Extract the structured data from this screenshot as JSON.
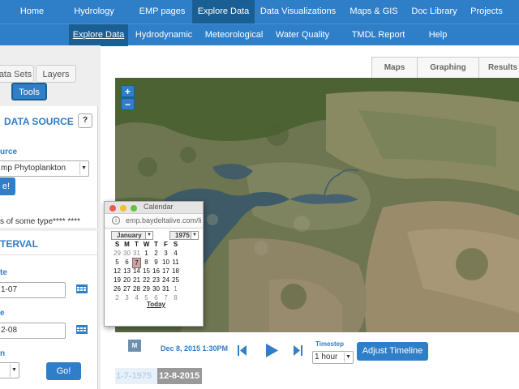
{
  "topnav": {
    "items": [
      "Home",
      "Hydrology Graphs",
      "EMP pages",
      "Explore Data",
      "Data Visualizations",
      "Maps & GIS",
      "Doc Library",
      "Projects"
    ]
  },
  "subnav": {
    "items": [
      "Explore Data",
      "Hydrodynamic",
      "Meteorological",
      "Water Quality",
      "TMDL Report Cards",
      "Help"
    ]
  },
  "left": {
    "tabs": [
      "ata Sets",
      "Layers"
    ],
    "tools_label": "Tools",
    "datasource_title": "DATA SOURCE",
    "help_label": "?",
    "source_label": "urce",
    "source_value": "mp Phytoplankton",
    "go1_label": "e!",
    "note": "s of some type**** ****",
    "interval_title": "TERVAL",
    "start_label": "te",
    "start_value": "1-07",
    "end_label": "e",
    "end_value": "2-08",
    "step_label": "n",
    "go2_label": "Go!"
  },
  "right_tabs": [
    "Maps",
    "Graphing",
    "Results"
  ],
  "map": {
    "zoom_in": "+",
    "zoom_out": "−"
  },
  "timeline": {
    "m_badge": "M",
    "datetime": "Dec 8, 2015 1:30PM",
    "timestep_label": "Timestep",
    "timestep_value": "1 hour",
    "adjust_label": "Adjust Timeline",
    "start": "1-7-1975",
    "end": "12-8-2015"
  },
  "calendar": {
    "window_title": "Calendar",
    "url": "emp.baydeltalive.com/livi",
    "month": "January",
    "year": "1975",
    "weekdays": [
      "S",
      "M",
      "T",
      "W",
      "T",
      "F",
      "S"
    ],
    "weeks": [
      [
        "29",
        "30",
        "31",
        "1",
        "2",
        "3",
        "4"
      ],
      [
        "5",
        "6",
        "7",
        "8",
        "9",
        "10",
        "11"
      ],
      [
        "12",
        "13",
        "14",
        "15",
        "16",
        "17",
        "18"
      ],
      [
        "19",
        "20",
        "21",
        "22",
        "23",
        "24",
        "25"
      ],
      [
        "26",
        "27",
        "28",
        "29",
        "30",
        "31",
        "1"
      ],
      [
        "2",
        "3",
        "4",
        "5",
        "6",
        "7",
        "8"
      ]
    ],
    "selected_day": "7",
    "today_label": "Today"
  },
  "colors": {
    "primary": "#2f7ec8",
    "active": "#1a5f93"
  }
}
